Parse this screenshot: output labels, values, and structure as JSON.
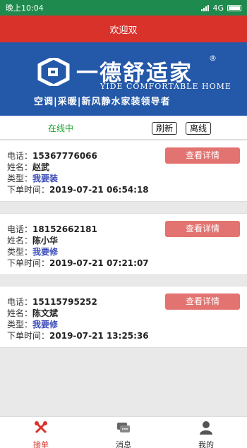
{
  "status_bar": {
    "time": "晚上10:04",
    "network": "4G"
  },
  "header": {
    "title": "欢迎双"
  },
  "banner": {
    "brand_cn": "一德舒适家",
    "registered": "®",
    "brand_en": "YIDE COMFORTABLE HOME",
    "slogan": "空调|采暖|新风静水家装领导者",
    "background_color": "#2458a8"
  },
  "toolbar": {
    "status": "在线中",
    "refresh_label": "刷新",
    "offline_label": "离线"
  },
  "labels": {
    "phone": "电话：",
    "name": "姓名：",
    "type": "类型：",
    "order_time": "下单时间：",
    "detail_button": "查看详情"
  },
  "orders": [
    {
      "phone": "15367776066",
      "name": "赵武",
      "type": "我要装",
      "order_time": "2019-07-21 06:54:18"
    },
    {
      "phone": "18152662181",
      "name": "陈小华",
      "type": "我要修",
      "order_time": "2019-07-21 07:21:07"
    },
    {
      "phone": "15115795252",
      "name": "陈文斌",
      "type": "我要修",
      "order_time": "2019-07-21 13:25:36"
    }
  ],
  "tabs": [
    {
      "label": "接单",
      "icon": "tools-icon",
      "active": true
    },
    {
      "label": "消息",
      "icon": "message-icon",
      "active": false
    },
    {
      "label": "我的",
      "icon": "user-icon",
      "active": false
    }
  ],
  "colors": {
    "header_red": "#d9322b",
    "status_green": "#1f8a4d",
    "online_green": "#1aa12a",
    "detail_button": "#e27370",
    "type_blue": "#3b4bb7"
  }
}
